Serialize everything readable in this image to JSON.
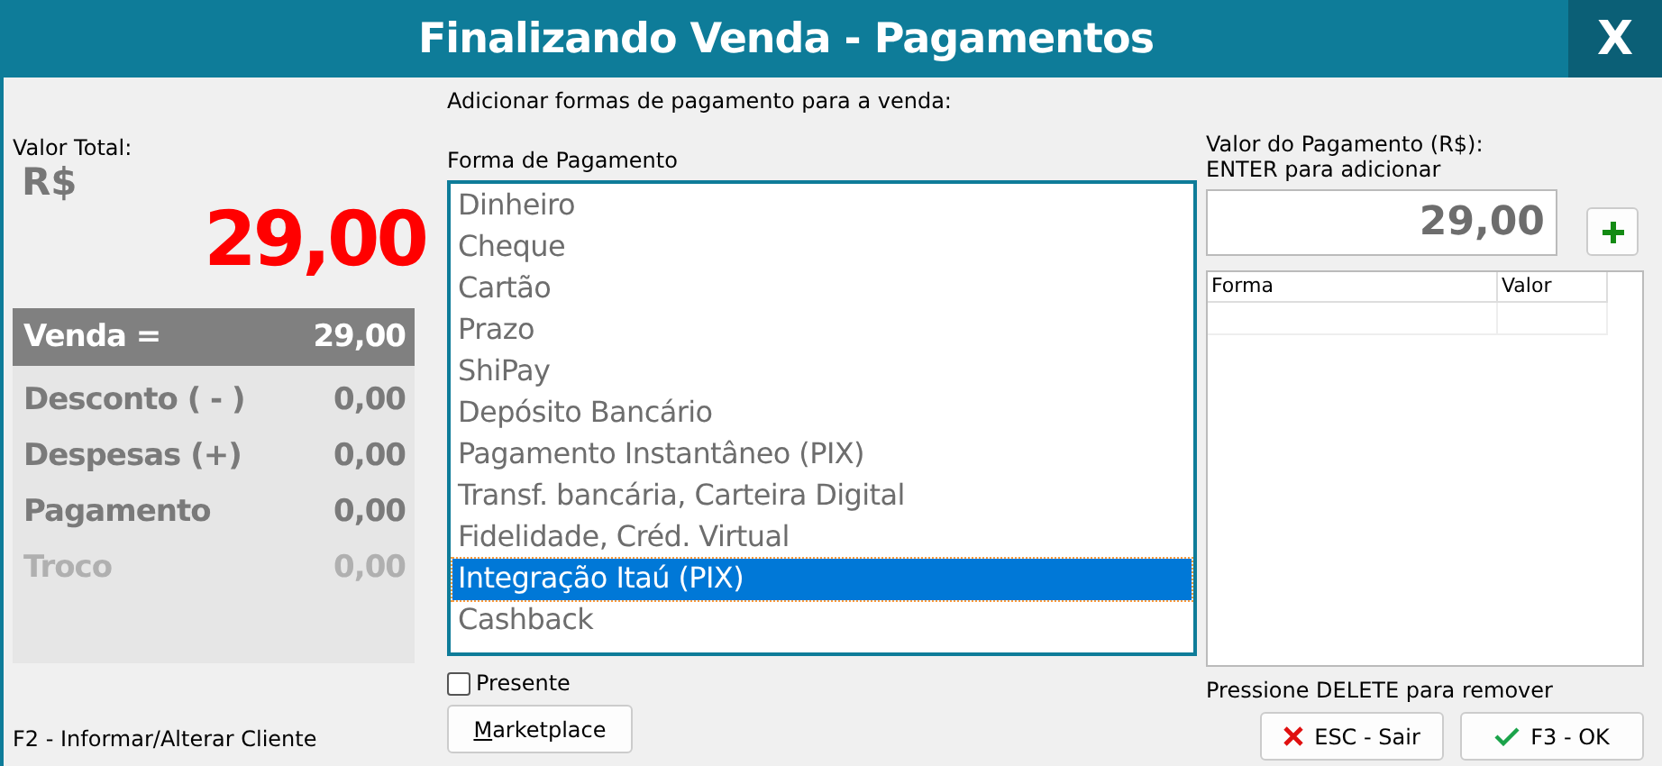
{
  "window": {
    "title": "Finalizando Venda - Pagamentos",
    "close": "X"
  },
  "total": {
    "label": "Valor Total:",
    "currency": "R$",
    "value": "29,00"
  },
  "summary": [
    {
      "kind": "header",
      "label": "Venda =",
      "value": "29,00"
    },
    {
      "kind": "normal",
      "label": "Desconto ( - )",
      "value": "0,00"
    },
    {
      "kind": "normal",
      "label": "Despesas (+)",
      "value": "0,00"
    },
    {
      "kind": "normal",
      "label": "Pagamento",
      "value": "0,00"
    },
    {
      "kind": "muted",
      "label": "Troco",
      "value": "0,00"
    }
  ],
  "customer_hint": "F2 - Informar/Alterar Cliente",
  "caption": "Adicionar formas de pagamento para a venda:",
  "payment_list": {
    "label": "Forma de Pagamento",
    "items": [
      {
        "label": "Dinheiro",
        "selected": false
      },
      {
        "label": "Cheque",
        "selected": false
      },
      {
        "label": "Cartão",
        "selected": false
      },
      {
        "label": "Prazo",
        "selected": false
      },
      {
        "label": "ShiPay",
        "selected": false
      },
      {
        "label": "Depósito Bancário",
        "selected": false
      },
      {
        "label": "Pagamento Instantâneo (PIX)",
        "selected": false
      },
      {
        "label": "Transf. bancária, Carteira Digital",
        "selected": false
      },
      {
        "label": "Fidelidade, Créd. Virtual",
        "selected": false
      },
      {
        "label": "Integração Itaú (PIX)",
        "selected": true
      },
      {
        "label": "Cashback",
        "selected": false
      }
    ]
  },
  "gift": {
    "label": "Presente",
    "checked": false
  },
  "marketplace_button": {
    "mnemonic": "M",
    "rest": "arketplace"
  },
  "amount": {
    "label": "Valor do Pagamento (R$):",
    "hint": "ENTER para adicionar",
    "value": "29,00"
  },
  "payments_table": {
    "columns": [
      "Forma",
      "Valor"
    ]
  },
  "delete_hint": "Pressione DELETE para remover",
  "buttons": [
    {
      "kind": "cancel",
      "label": "ESC - Sair"
    },
    {
      "kind": "ok",
      "label": "F3 - OK"
    }
  ]
}
